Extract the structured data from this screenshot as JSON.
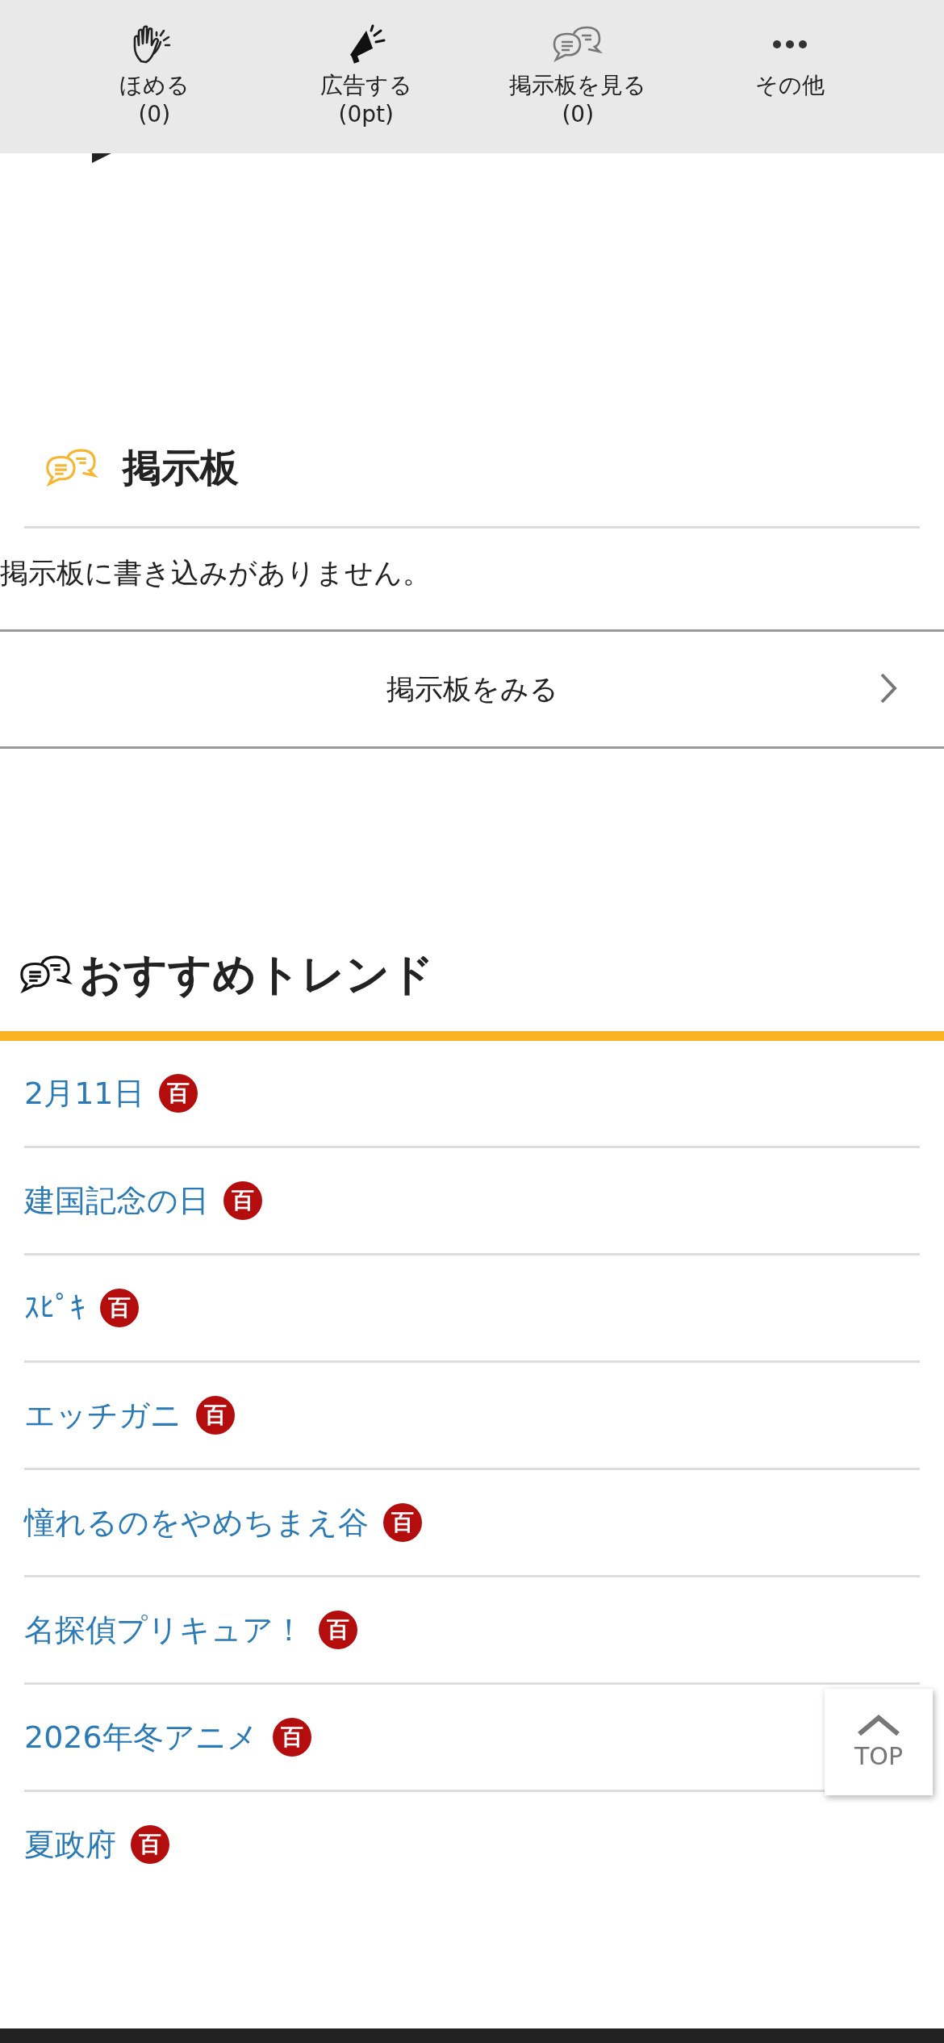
{
  "action_bar": {
    "items": [
      {
        "kind": "clap",
        "label": "ほめる",
        "count": "(0)"
      },
      {
        "kind": "megaphone",
        "label": "広告する",
        "count": "(0pt)"
      },
      {
        "kind": "chat",
        "label": "掲示板を見る",
        "count": "(0)"
      },
      {
        "kind": "more",
        "label": "その他"
      }
    ]
  },
  "board": {
    "title": "掲示板",
    "message": "掲示板に書き込みがありません。",
    "link": "掲示板をみる"
  },
  "trends": {
    "title": "おすすめトレンド",
    "items": [
      {
        "label": "2月11日",
        "badge": "百"
      },
      {
        "label": "建国記念の日",
        "badge": "百"
      },
      {
        "label": "ｽﾋﾟｷ",
        "badge": "百"
      },
      {
        "label": "エッチガニ",
        "badge": "百"
      },
      {
        "label": "憧れるのをやめちまえ谷",
        "badge": "百"
      },
      {
        "label": "名探偵プリキュア！",
        "badge": "百"
      },
      {
        "label": "2026年冬アニメ",
        "badge": "百"
      },
      {
        "label": "夏政府",
        "badge": "百"
      }
    ]
  },
  "top_button": {
    "label": "TOP"
  }
}
